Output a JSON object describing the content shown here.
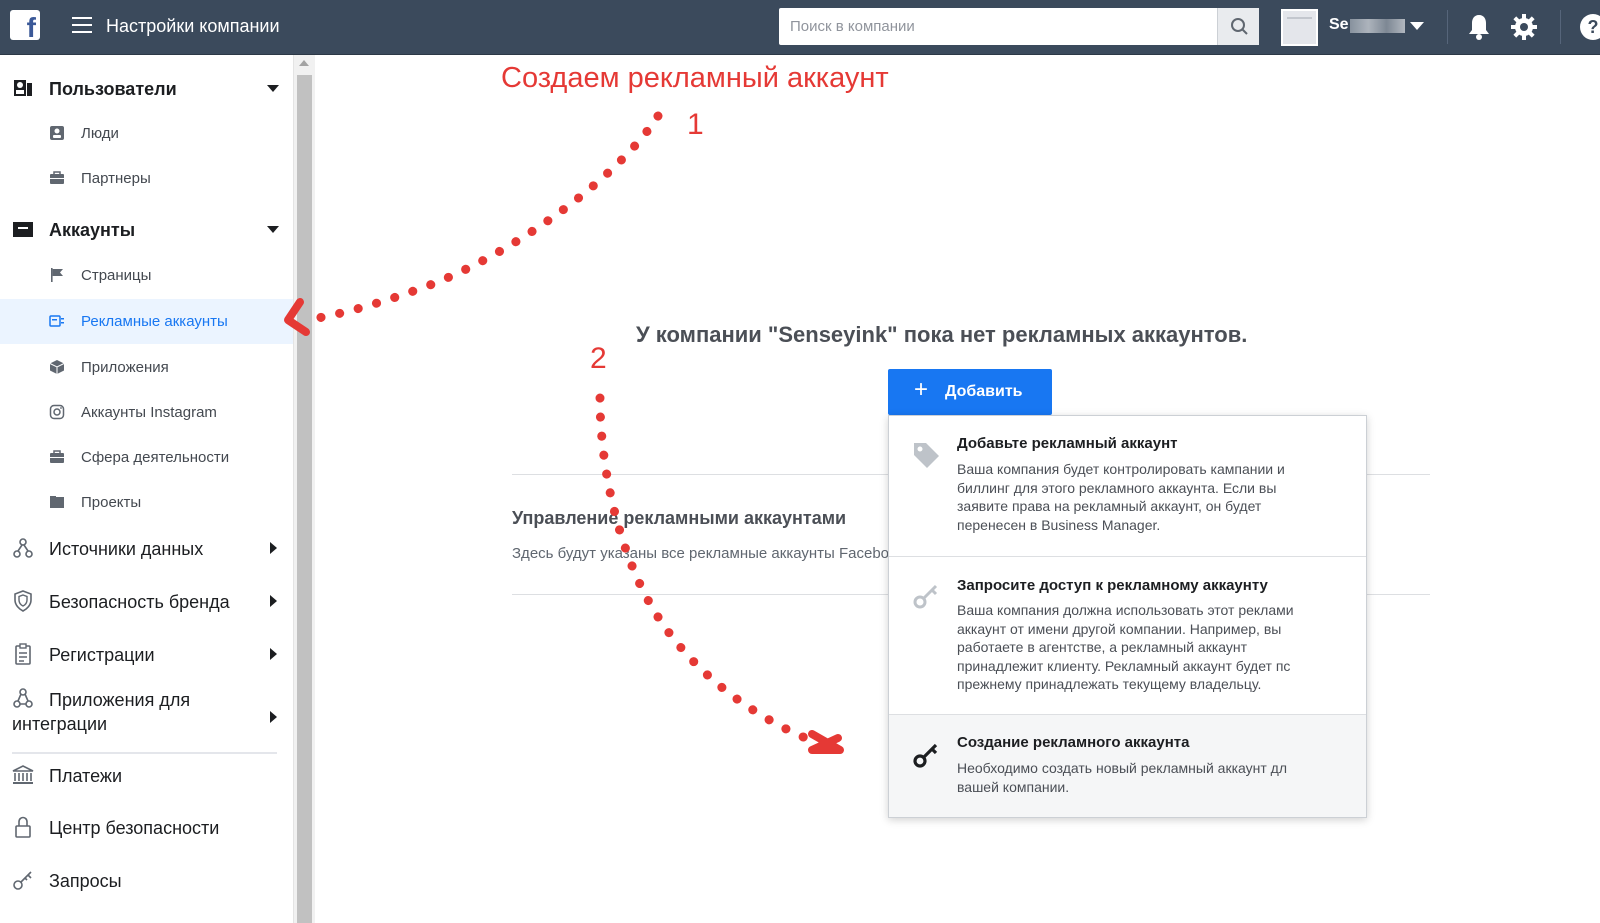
{
  "header": {
    "logo_letter": "f",
    "title": "Настройки компании",
    "search_placeholder": "Поиск в компании",
    "account_name": "Se",
    "help_glyph": "?"
  },
  "sidebar": {
    "sections": [
      {
        "label": "Пользователи",
        "icon": "users-icon",
        "expanded": true,
        "items": [
          {
            "label": "Люди",
            "icon": "person-icon"
          },
          {
            "label": "Партнеры",
            "icon": "briefcase-icon"
          }
        ]
      },
      {
        "label": "Аккаунты",
        "icon": "folder-icon",
        "expanded": true,
        "items": [
          {
            "label": "Страницы",
            "icon": "flag-icon"
          },
          {
            "label": "Рекламные аккаунты",
            "icon": "ad-account-icon",
            "active": true
          },
          {
            "label": "Приложения",
            "icon": "cube-icon"
          },
          {
            "label": "Аккаунты Instagram",
            "icon": "instagram-icon"
          },
          {
            "label": "Сфера деятельности",
            "icon": "briefcase-icon"
          },
          {
            "label": "Проекты",
            "icon": "folder-icon"
          }
        ]
      }
    ],
    "collapsed_sections": [
      {
        "label": "Источники данных",
        "icon": "data-sources-icon"
      },
      {
        "label": "Безопасность бренда",
        "icon": "shield-icon"
      },
      {
        "label": "Регистрации",
        "icon": "clipboard-icon"
      },
      {
        "label": "Приложения для интеграции",
        "label_line1": "Приложения для",
        "label_line2": "интеграции",
        "icon": "integration-icon"
      }
    ],
    "bottom_items": [
      {
        "label": "Платежи",
        "icon": "bank-icon"
      },
      {
        "label": "Центр безопасности",
        "icon": "lock-icon"
      },
      {
        "label": "Запросы",
        "icon": "key-icon"
      }
    ]
  },
  "annotations": {
    "title": "Создаем рекламный аккаунт",
    "step1": "1",
    "step2": "2",
    "color": "#e53935"
  },
  "main": {
    "empty_title": "У компании \"Senseyink\" пока нет рекламных аккаунтов.",
    "add_button": {
      "plus": "+",
      "label": "Добавить"
    },
    "manage_title": "Управление рекламными аккаунтами",
    "manage_desc": "Здесь будут указаны все рекламные аккаунты Facebook"
  },
  "dropdown": {
    "options": [
      {
        "title": "Добавьте рекламный аккаунт",
        "icon": "tag-icon",
        "lines": [
          "Ваша компания будет контролировать кампании и",
          "биллинг для этого рекламного аккаунта. Если вы",
          "заявите права на рекламный аккаунт, он будет",
          "перенесен в Business Manager."
        ]
      },
      {
        "title": "Запросите доступ к рекламному аккаунту",
        "icon": "key-icon",
        "lines": [
          "Ваша компания должна использовать этот реклами",
          "аккаунт от имени другой компании. Например, вы",
          "работаете в агентстве, а рекламный аккаунт",
          "принадлежит клиенту. Рекламный аккаунт будет пс",
          "прежнему принадлежать текущему владельцу."
        ]
      },
      {
        "title": "Создание рекламного аккаунта",
        "icon": "key-icon",
        "lines": [
          "Необходимо создать новый рекламный аккаунт дл",
          "вашей компании."
        ]
      }
    ]
  },
  "colors": {
    "topbar": "#3b4a5c",
    "accent": "#1877f2",
    "active_bg": "#ebf4ff"
  }
}
